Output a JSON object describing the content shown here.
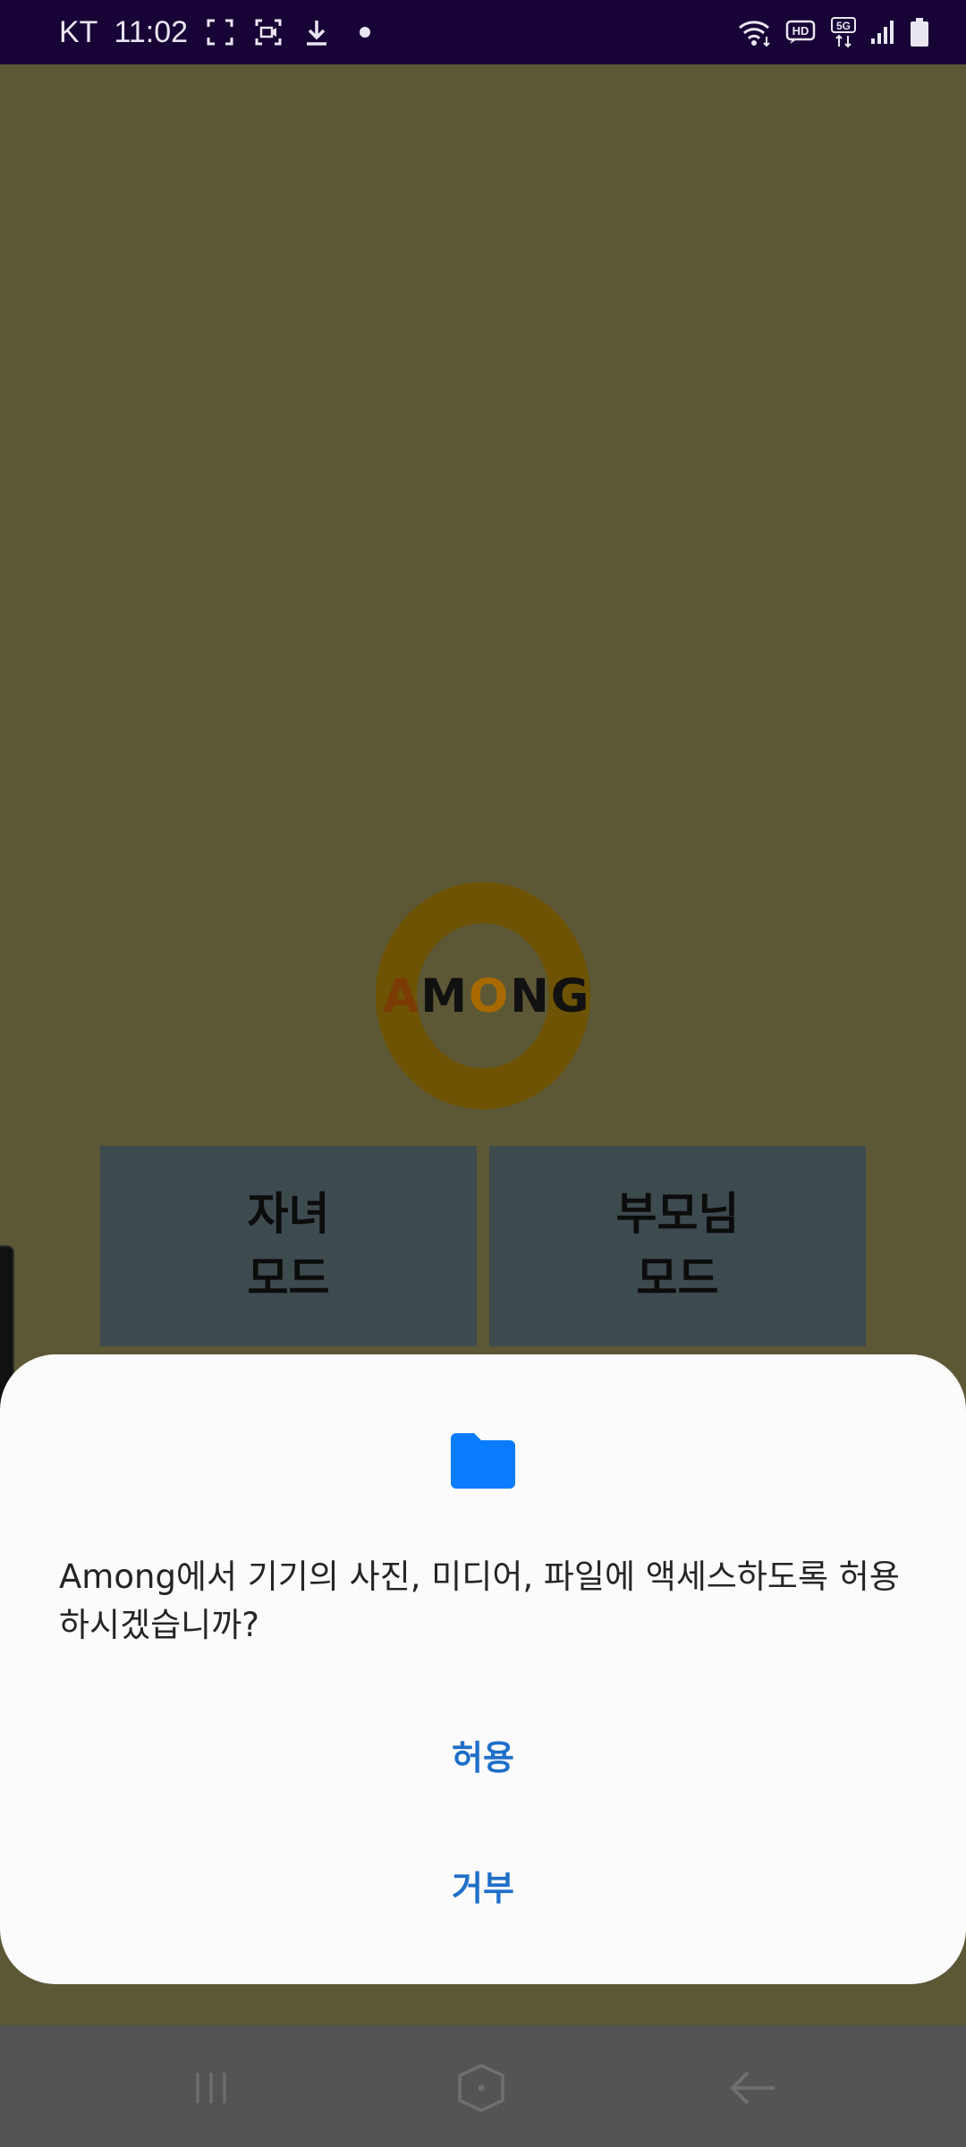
{
  "status_bar": {
    "carrier": "KT",
    "time": "11:02",
    "icons_left": [
      "screenshot-frame-icon",
      "screen-record-icon",
      "download-icon",
      "notification-dot-icon"
    ],
    "icons_right": [
      "wifi-icon",
      "hd-voice-icon",
      "5g-icon",
      "signal-icon",
      "battery-icon"
    ],
    "hd_label": "HD",
    "network_label": "5G"
  },
  "app": {
    "logo_letters": [
      "A",
      "M",
      "O",
      "N",
      "G"
    ],
    "buttons": {
      "child_mode": "자녀\n모드",
      "parent_mode": "부모님\n모드"
    }
  },
  "permission_dialog": {
    "icon": "folder-icon",
    "message": "Among에서 기기의 사진, 미디어, 파일에 액세스하도록 허용하시겠습니까?",
    "allow_label": "허용",
    "deny_label": "거부"
  },
  "nav_bar": {
    "icons": [
      "recents-icon",
      "home-icon",
      "back-icon"
    ]
  },
  "colors": {
    "app_background": "#5c5836",
    "status_bar": "#170336",
    "mode_button": "#3d4a4e",
    "logo_ring": "#6e5305",
    "dialog_background": "#fbfbfb",
    "dialog_action": "#1f6fc8",
    "folder_icon": "#0a7cff",
    "nav_bar": "#545454"
  }
}
